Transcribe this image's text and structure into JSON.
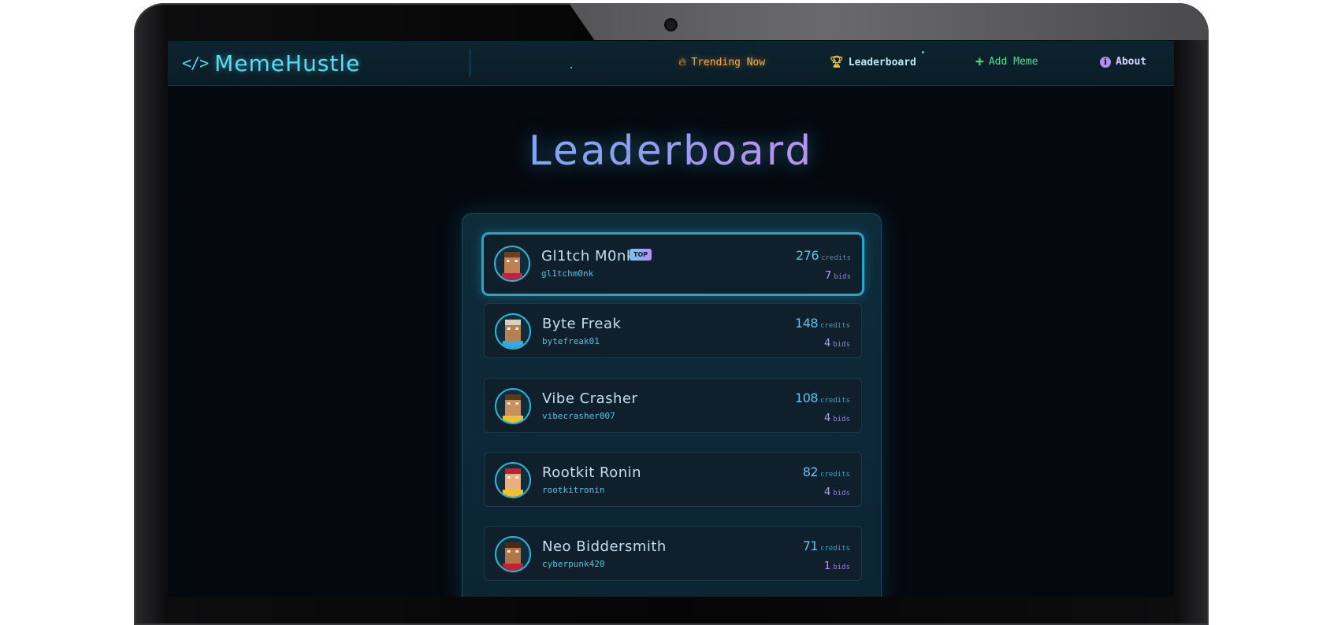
{
  "brand": {
    "icon": "</>",
    "name": "MemeHustle"
  },
  "nav": {
    "trending": {
      "icon": "flame-icon",
      "label": "Trending Now"
    },
    "leaderboard": {
      "icon": "trophy-icon",
      "label": "Leaderboard"
    },
    "add": {
      "icon": "plus-icon",
      "label": "Add Meme"
    },
    "about": {
      "icon": "info-icon",
      "label": "About"
    }
  },
  "page": {
    "title": "Leaderboard"
  },
  "leaderboard": {
    "badge_top": "TOP",
    "credits_unit": "credits",
    "bids_unit": "bids",
    "entries": [
      {
        "name": "Gl1tch M0nk",
        "handle": "gl1tchm0nk",
        "credits": "276",
        "bids": "7"
      },
      {
        "name": "Byte Freak",
        "handle": "bytefreak01",
        "credits": "148",
        "bids": "4"
      },
      {
        "name": "Vibe Crasher",
        "handle": "vibecrasher007",
        "credits": "108",
        "bids": "4"
      },
      {
        "name": "Rootkit Ronin",
        "handle": "rootkitronin",
        "credits": "82",
        "bids": "4"
      },
      {
        "name": "Neo Biddersmith",
        "handle": "cyberpunk420",
        "credits": "71",
        "bids": "1"
      }
    ]
  },
  "colors": {
    "accent": "#2ab8d4",
    "purple": "#b59af3",
    "background": "#04080f"
  }
}
